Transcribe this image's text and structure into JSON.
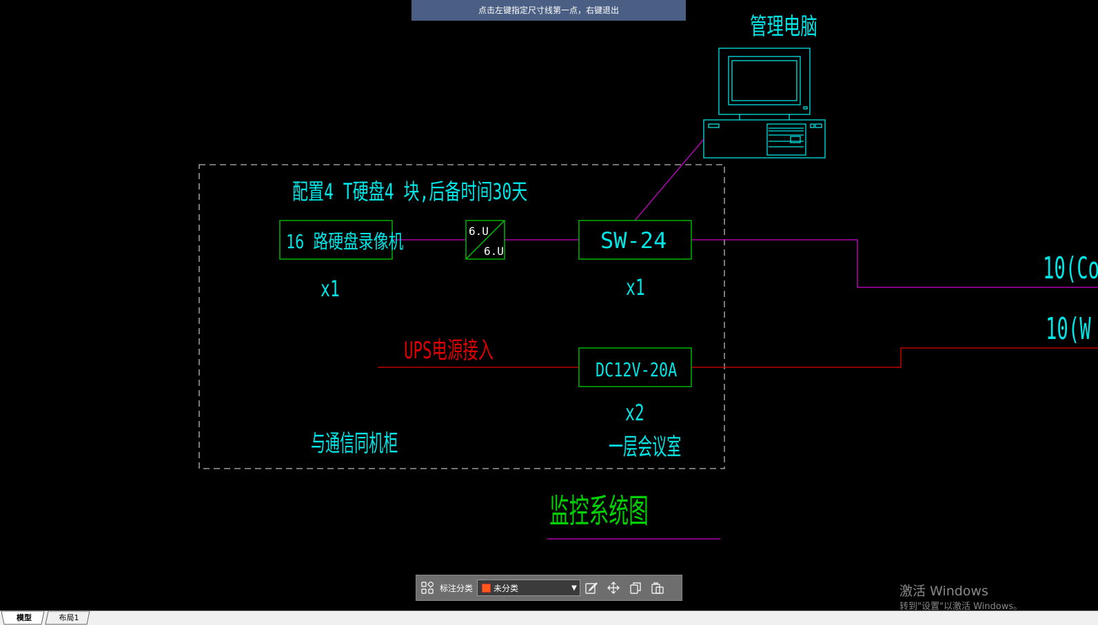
{
  "prompt": {
    "text": "点击左键指定尺寸线第一点，右键退出"
  },
  "drawing": {
    "note": "配置4 T硬盘4 块,后备时间30天",
    "pc_label": "管理电脑",
    "nvr_label": "16 路硬盘录像机",
    "nvr_qty": "x1",
    "converter_top": "6.U",
    "converter_bottom": "6.U",
    "switch_label": "SW-24",
    "switch_qty": "x1",
    "ups_label": "UPS电源接入",
    "psu_label": "DC12V-20A",
    "psu_qty": "x2",
    "cabinet_label": "与通信同机柜",
    "room_label": "一层会议室",
    "title": "监控系统图",
    "cable1": "10(Co",
    "cable2": "10(W"
  },
  "toolbar": {
    "category_label": "标注分类",
    "selected_category": "未分类"
  },
  "tabs": [
    {
      "label": "模型"
    },
    {
      "label": "布局1"
    }
  ],
  "watermark": {
    "line1": "激活 Windows",
    "line2": "转到\"设置\"以激活 Windows。"
  },
  "colors": {
    "background": "#000000",
    "cyan": "#00e5e5",
    "green": "#00d000",
    "magenta": "#d000d0",
    "red": "#e00000",
    "dashed_border": "#bbbbbb"
  }
}
